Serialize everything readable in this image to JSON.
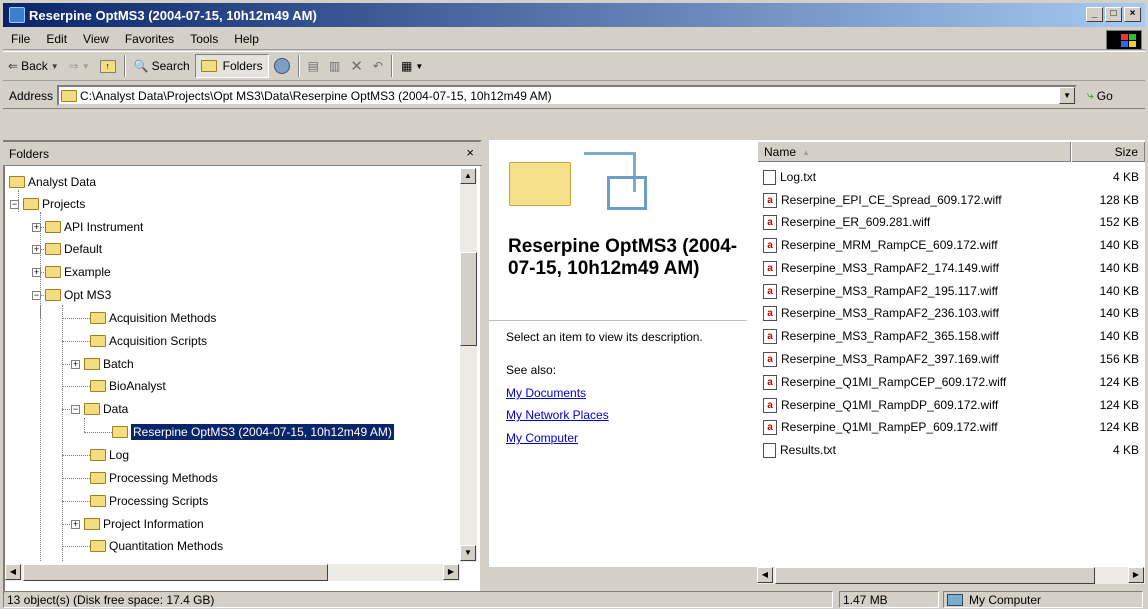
{
  "window": {
    "title": "Reserpine OptMS3 (2004-07-15, 10h12m49 AM)",
    "minimize": "_",
    "maximize": "□",
    "close": "×"
  },
  "menu": [
    "File",
    "Edit",
    "View",
    "Favorites",
    "Tools",
    "Help"
  ],
  "toolbar": {
    "back": "Back",
    "search": "Search",
    "folders": "Folders"
  },
  "address": {
    "label": "Address",
    "value": "C:\\Analyst Data\\Projects\\Opt MS3\\Data\\Reserpine OptMS3 (2004-07-15, 10h12m49 AM)",
    "go": "Go"
  },
  "folders_pane": {
    "title": "Folders",
    "close": "×",
    "tree": [
      {
        "label": "Analyst Data"
      },
      {
        "label": "Projects",
        "toggle": "−"
      },
      {
        "label": "API Instrument",
        "toggle": "+"
      },
      {
        "label": "Default",
        "toggle": "+"
      },
      {
        "label": "Example",
        "toggle": "+"
      },
      {
        "label": "Opt MS3",
        "toggle": "−"
      },
      {
        "label": "Acquisition Methods"
      },
      {
        "label": "Acquisition Scripts"
      },
      {
        "label": "Batch",
        "toggle": "+"
      },
      {
        "label": "BioAnalyst"
      },
      {
        "label": "Data",
        "toggle": "−"
      },
      {
        "label": "Reserpine OptMS3 (2004-07-15, 10h12m49 AM)",
        "selected": true
      },
      {
        "label": "Log"
      },
      {
        "label": "Processing Methods"
      },
      {
        "label": "Processing Scripts"
      },
      {
        "label": "Project Information",
        "toggle": "+"
      },
      {
        "label": "Quantitation Methods"
      }
    ]
  },
  "web_view": {
    "folder_title": "Reserpine OptMS3 (2004-07-15, 10h12m49 AM)",
    "description": "Select an item to view its description.",
    "see_also": "See also:",
    "links": [
      "My Documents",
      "My Network Places",
      "My Computer"
    ]
  },
  "file_list": {
    "columns": [
      "Name",
      "Size"
    ],
    "sort_glyph": "▲",
    "rows": [
      {
        "name": "Log.txt",
        "size": "4 KB",
        "icon": "text-file-icon"
      },
      {
        "name": "Reserpine_EPI_CE_Spread_609.172.wiff",
        "size": "128 KB",
        "icon": "wiff-file-icon"
      },
      {
        "name": "Reserpine_ER_609.281.wiff",
        "size": "152 KB",
        "icon": "wiff-file-icon"
      },
      {
        "name": "Reserpine_MRM_RampCE_609.172.wiff",
        "size": "140 KB",
        "icon": "wiff-file-icon"
      },
      {
        "name": "Reserpine_MS3_RampAF2_174.149.wiff",
        "size": "140 KB",
        "icon": "wiff-file-icon"
      },
      {
        "name": "Reserpine_MS3_RampAF2_195.117.wiff",
        "size": "140 KB",
        "icon": "wiff-file-icon"
      },
      {
        "name": "Reserpine_MS3_RampAF2_236.103.wiff",
        "size": "140 KB",
        "icon": "wiff-file-icon"
      },
      {
        "name": "Reserpine_MS3_RampAF2_365.158.wiff",
        "size": "140 KB",
        "icon": "wiff-file-icon"
      },
      {
        "name": "Reserpine_MS3_RampAF2_397.169.wiff",
        "size": "156 KB",
        "icon": "wiff-file-icon"
      },
      {
        "name": "Reserpine_Q1MI_RampCEP_609.172.wiff",
        "size": "124 KB",
        "icon": "wiff-file-icon"
      },
      {
        "name": "Reserpine_Q1MI_RampDP_609.172.wiff",
        "size": "124 KB",
        "icon": "wiff-file-icon"
      },
      {
        "name": "Reserpine_Q1MI_RampEP_609.172.wiff",
        "size": "124 KB",
        "icon": "wiff-file-icon"
      },
      {
        "name": "Results.txt",
        "size": "4 KB",
        "icon": "text-file-icon"
      }
    ]
  },
  "status": {
    "objects": "13 object(s) (Disk free space: 17.4 GB)",
    "size": "1.47 MB",
    "zone": "My Computer"
  },
  "colors": {
    "title_start": "#0a246a",
    "title_end": "#a6caf0",
    "selection": "#0a246a",
    "link": "#0000cc",
    "face": "#d4d0c8"
  }
}
